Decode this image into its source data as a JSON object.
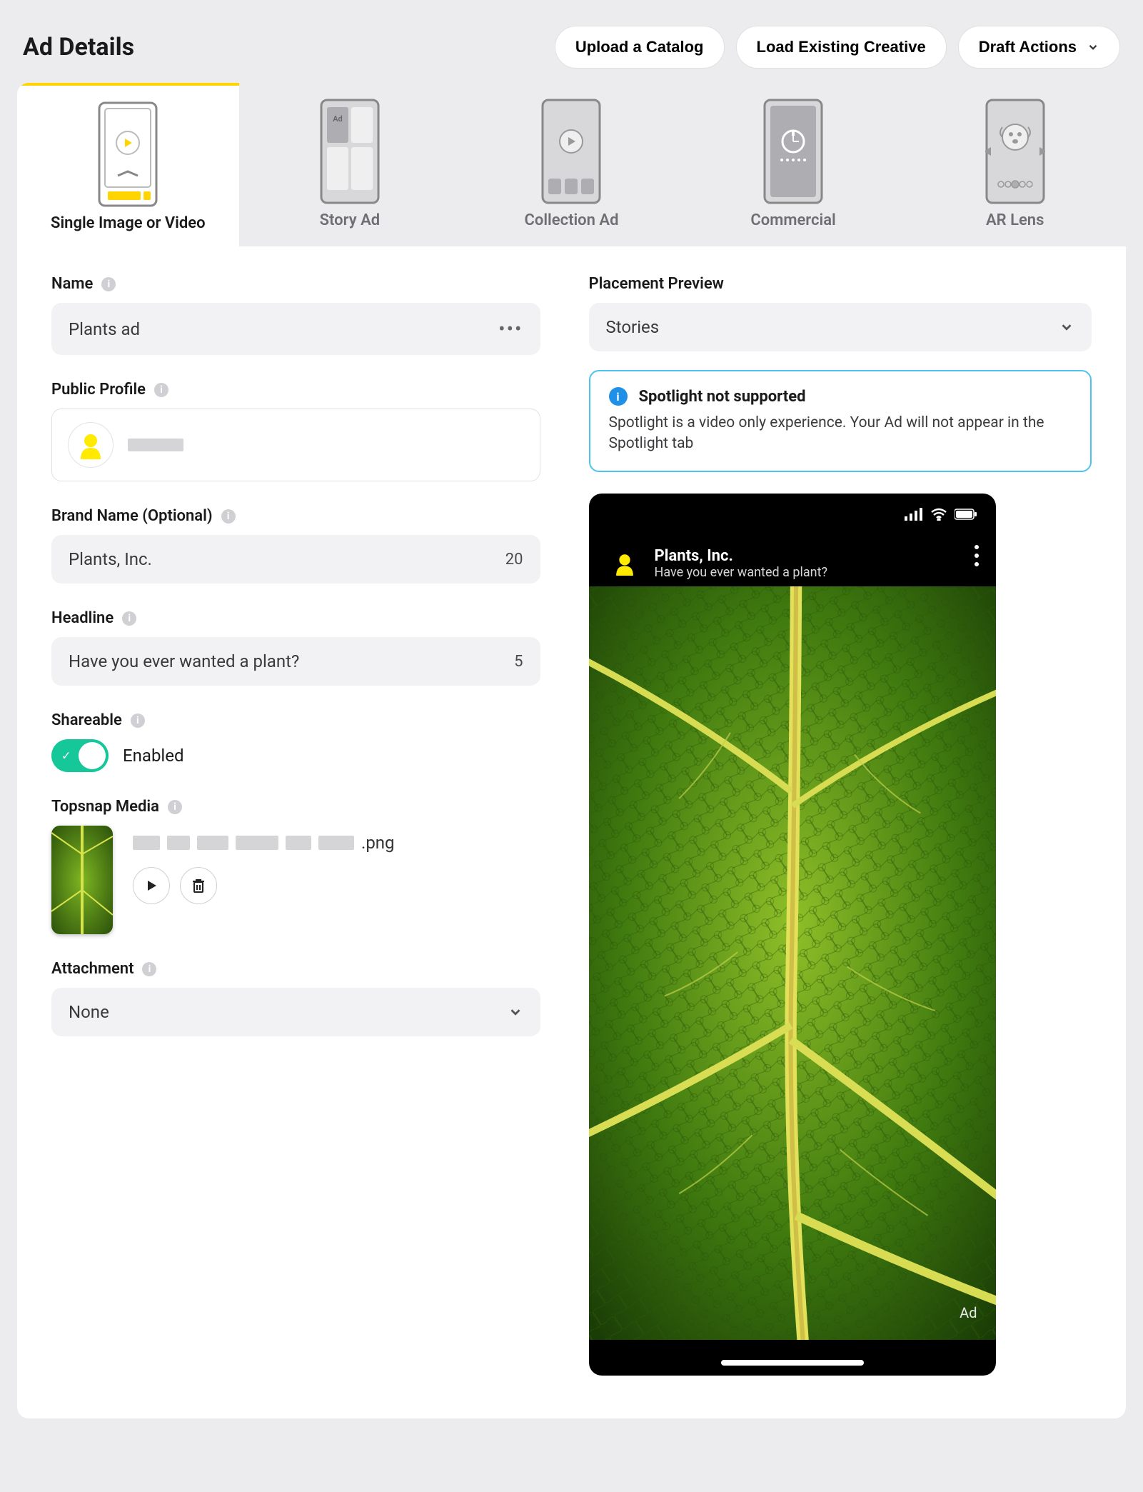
{
  "header": {
    "title": "Ad Details",
    "upload_catalog": "Upload a Catalog",
    "load_existing": "Load Existing Creative",
    "draft_actions": "Draft Actions"
  },
  "tabs": [
    {
      "label": "Single Image or Video",
      "id": "single"
    },
    {
      "label": "Story Ad",
      "id": "story"
    },
    {
      "label": "Collection Ad",
      "id": "collection"
    },
    {
      "label": "Commercial",
      "id": "commercial"
    },
    {
      "label": "AR Lens",
      "id": "arlens"
    }
  ],
  "form": {
    "name_label": "Name",
    "name_value": "Plants ad",
    "profile_label": "Public Profile",
    "brand_label": "Brand Name (Optional)",
    "brand_value": "Plants, Inc.",
    "brand_count": "20",
    "headline_label": "Headline",
    "headline_value": "Have you ever wanted a plant?",
    "headline_count": "5",
    "shareable_label": "Shareable",
    "shareable_state": "Enabled",
    "topsnap_label": "Topsnap Media",
    "file_ext": ".png",
    "attachment_label": "Attachment",
    "attachment_value": "None"
  },
  "preview": {
    "section_label": "Placement Preview",
    "placement_value": "Stories",
    "notice_title": "Spotlight not supported",
    "notice_body": "Spotlight is a video only experience. Your Ad will not appear in the Spotlight tab",
    "brand": "Plants, Inc.",
    "headline": "Have you ever wanted a plant?",
    "ad_badge": "Ad"
  }
}
